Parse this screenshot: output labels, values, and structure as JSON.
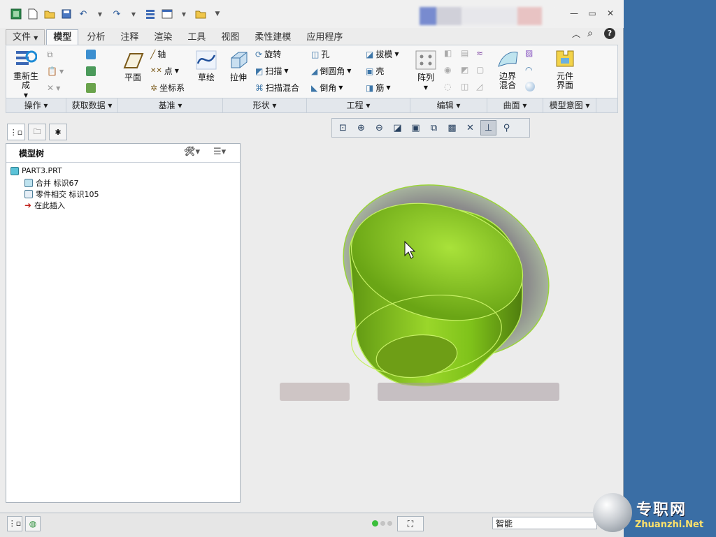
{
  "app": {
    "menu_tabs": [
      "文件",
      "模型",
      "分析",
      "注释",
      "渲染",
      "工具",
      "视图",
      "柔性建模",
      "应用程序"
    ],
    "active_tab": "模型"
  },
  "ribbon": {
    "operations": {
      "regenerate_label": "重新生成",
      "group_label": "操作"
    },
    "get_data": {
      "group_label": "获取数据"
    },
    "datum": {
      "plane": "平面",
      "axis": "轴",
      "point": "点",
      "csys": "坐标系",
      "sketch": "草绘",
      "group_label": "基准"
    },
    "shapes": {
      "extrude": "拉伸",
      "revolve": "旋转",
      "sweep": "扫描",
      "swept_blend": "扫描混合",
      "group_label": "形状"
    },
    "engineering": {
      "hole": "孔",
      "round": "倒圆角",
      "chamfer": "倒角",
      "draft": "拔模",
      "shell": "壳",
      "rib": "筋",
      "group_label": "工程"
    },
    "editing": {
      "pattern": "阵列",
      "group_label": "编辑"
    },
    "surfaces": {
      "boundary_blend": "边界混合",
      "group_label": "曲面"
    },
    "model_intent": {
      "component_interface": "元件界面",
      "group_label": "模型意图"
    }
  },
  "model_tree": {
    "title": "模型树",
    "items": [
      {
        "label": "PART3.PRT"
      },
      {
        "label": "合并 标识67"
      },
      {
        "label": "零件相交 标识105"
      },
      {
        "label": "在此插入"
      }
    ]
  },
  "status": {
    "filter_value": "智能"
  },
  "watermark": {
    "text": "专职网",
    "url": "Zhuanzhi.Net"
  },
  "colors": {
    "model_green": "#7fc21a",
    "desktop_blue": "#3a6ea5",
    "insert_arrow": "#c0201a"
  }
}
